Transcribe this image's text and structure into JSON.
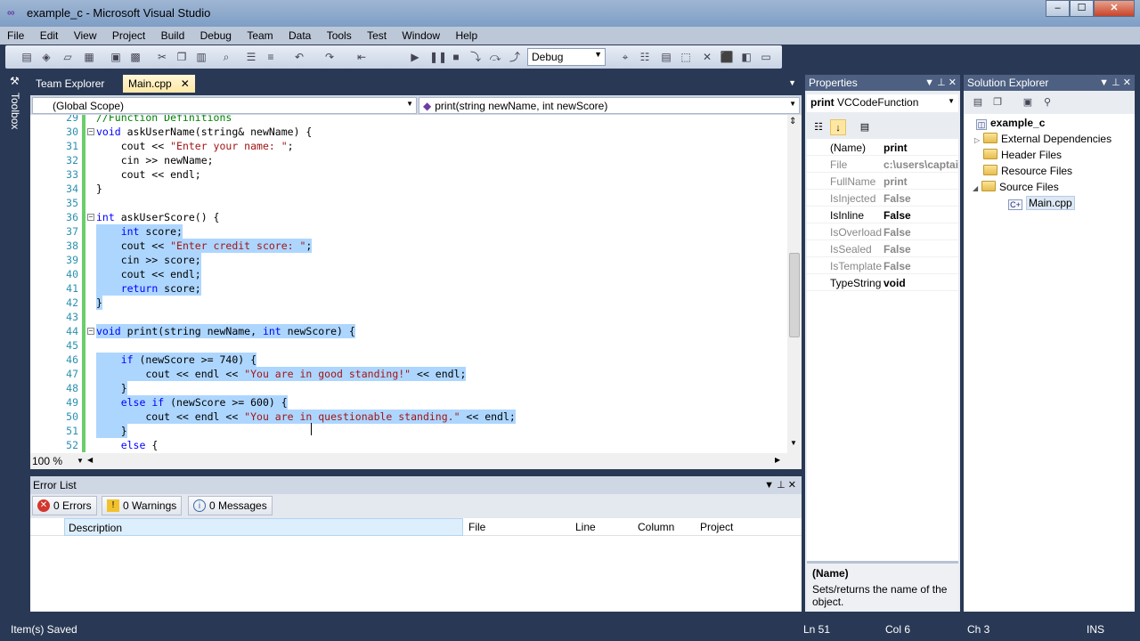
{
  "window": {
    "title": "example_c - Microsoft Visual Studio",
    "min": "‒",
    "max": "☐",
    "close": "✕"
  },
  "menu": [
    "File",
    "Edit",
    "View",
    "Project",
    "Build",
    "Debug",
    "Team",
    "Data",
    "Tools",
    "Test",
    "Window",
    "Help"
  ],
  "toolbar": {
    "config": "Debug"
  },
  "toolbox_label": "Toolbox",
  "tabs": [
    {
      "label": "Team Explorer",
      "active": false
    },
    {
      "label": "Main.cpp",
      "active": true
    }
  ],
  "navbar": {
    "scope": "(Global Scope)",
    "member": "print(string newName, int newScore)"
  },
  "code_lines": [
    {
      "n": "29",
      "t": "//Function Definitions"
    },
    {
      "n": "30",
      "t": "void askUserName(string& newName) {"
    },
    {
      "n": "31",
      "t": "    cout << \"Enter your name: \";"
    },
    {
      "n": "32",
      "t": "    cin >> newName;"
    },
    {
      "n": "33",
      "t": "    cout << endl;"
    },
    {
      "n": "34",
      "t": "}"
    },
    {
      "n": "35",
      "t": ""
    },
    {
      "n": "36",
      "t": "int askUserScore() {"
    },
    {
      "n": "37",
      "t": "    int score;"
    },
    {
      "n": "38",
      "t": "    cout << \"Enter credit score: \";"
    },
    {
      "n": "39",
      "t": "    cin >> score;"
    },
    {
      "n": "40",
      "t": "    cout << endl;"
    },
    {
      "n": "41",
      "t": "    return score;"
    },
    {
      "n": "42",
      "t": "}"
    },
    {
      "n": "43",
      "t": ""
    },
    {
      "n": "44",
      "t": "void print(string newName, int newScore) {"
    },
    {
      "n": "45",
      "t": ""
    },
    {
      "n": "46",
      "t": "    if (newScore >= 740) {"
    },
    {
      "n": "47",
      "t": "        cout << endl << \"You are in good standing!\" << endl;"
    },
    {
      "n": "48",
      "t": "    }"
    },
    {
      "n": "49",
      "t": "    else if (newScore >= 600) {"
    },
    {
      "n": "50",
      "t": "        cout << endl << \"You are in questionable standing.\" << endl;"
    },
    {
      "n": "51",
      "t": "    }"
    },
    {
      "n": "52",
      "t": "    else {"
    }
  ],
  "zoom": "100 %",
  "error_list": {
    "title": "Error List",
    "errors": "0 Errors",
    "warnings": "0 Warnings",
    "messages": "0 Messages",
    "columns": [
      "Description",
      "File",
      "Line",
      "Column",
      "Project"
    ]
  },
  "properties": {
    "title": "Properties",
    "object_name": "print",
    "object_type": "VCCodeFunction",
    "rows": [
      {
        "name": "(Name)",
        "value": "print",
        "dark": true
      },
      {
        "name": "File",
        "value": "c:\\users\\captain",
        "dark": false
      },
      {
        "name": "FullName",
        "value": "print",
        "dark": false
      },
      {
        "name": "IsInjected",
        "value": "False",
        "dark": false
      },
      {
        "name": "IsInline",
        "value": "False",
        "dark": true
      },
      {
        "name": "IsOverload",
        "value": "False",
        "dark": false
      },
      {
        "name": "IsSealed",
        "value": "False",
        "dark": false
      },
      {
        "name": "IsTemplate",
        "value": "False",
        "dark": false
      },
      {
        "name": "TypeString",
        "value": "void",
        "dark": true
      }
    ],
    "desc_title": "(Name)",
    "desc_text": "Sets/returns the name of the object."
  },
  "solution": {
    "title": "Solution Explorer",
    "project": "example_c",
    "items": [
      "External Dependencies",
      "Header Files",
      "Resource Files",
      "Source Files"
    ],
    "file": "Main.cpp"
  },
  "status": {
    "left": "Item(s) Saved",
    "ln": "Ln 51",
    "col": "Col 6",
    "ch": "Ch 3",
    "mode": "INS"
  },
  "colors": {
    "selection": "#add6ff",
    "keyword": "#0000ff",
    "string": "#a31515",
    "comment": "#008000",
    "chrome": "#293955"
  }
}
